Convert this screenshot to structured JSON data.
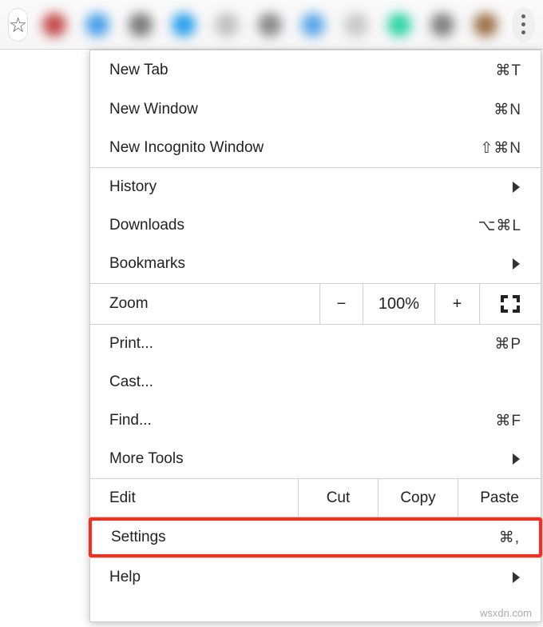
{
  "toolbar": {
    "extension_colors": [
      "#c44b4b",
      "#4aa0ea",
      "#7a7a7a",
      "#2aa1ec",
      "#c0c0c0",
      "#8a8a8a",
      "#5aa7ea",
      "#c7c7c7",
      "#2fd4a5",
      "#808080",
      "#9a7248"
    ]
  },
  "menu": {
    "new_tab": {
      "label": "New Tab",
      "shortcut": "⌘T"
    },
    "new_window": {
      "label": "New Window",
      "shortcut": "⌘N"
    },
    "new_incognito": {
      "label": "New Incognito Window",
      "shortcut": "⇧⌘N"
    },
    "history": {
      "label": "History"
    },
    "downloads": {
      "label": "Downloads",
      "shortcut": "⌥⌘L"
    },
    "bookmarks": {
      "label": "Bookmarks"
    },
    "zoom": {
      "label": "Zoom",
      "level": "100%"
    },
    "print": {
      "label": "Print...",
      "shortcut": "⌘P"
    },
    "cast": {
      "label": "Cast..."
    },
    "find": {
      "label": "Find...",
      "shortcut": "⌘F"
    },
    "more_tools": {
      "label": "More Tools"
    },
    "edit": {
      "label": "Edit",
      "cut": "Cut",
      "copy": "Copy",
      "paste": "Paste"
    },
    "settings": {
      "label": "Settings",
      "shortcut": "⌘,"
    },
    "help": {
      "label": "Help"
    }
  },
  "watermark": "wsxdn.com"
}
